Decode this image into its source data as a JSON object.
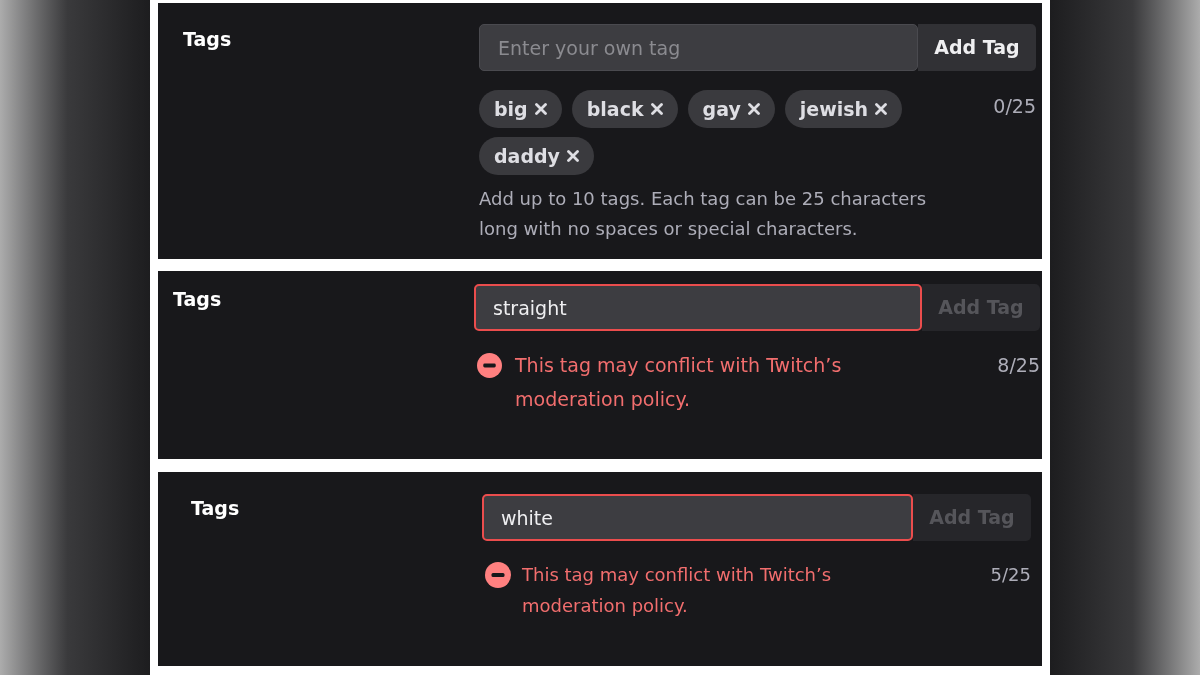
{
  "panels": [
    {
      "label": "Tags",
      "input": {
        "placeholder": "Enter your own tag",
        "invalid": false
      },
      "add_button": {
        "label": "Add Tag",
        "disabled": false
      },
      "tags": [
        "big",
        "black",
        "gay",
        "jewish",
        "daddy"
      ],
      "counter": "0/25",
      "help": "Add up to 10 tags. Each tag can be 25 characters long with no spaces or special characters."
    },
    {
      "label": "Tags",
      "input": {
        "value": "straight",
        "invalid": true
      },
      "add_button": {
        "label": "Add Tag",
        "disabled": true
      },
      "error": "This tag may conflict with Twitch’s moderation policy.",
      "counter": "8/25"
    },
    {
      "label": "Tags",
      "input": {
        "value": "white",
        "invalid": true
      },
      "add_button": {
        "label": "Add Tag",
        "disabled": true
      },
      "error": "This tag may conflict with Twitch’s moderation policy.",
      "counter": "5/25"
    }
  ]
}
